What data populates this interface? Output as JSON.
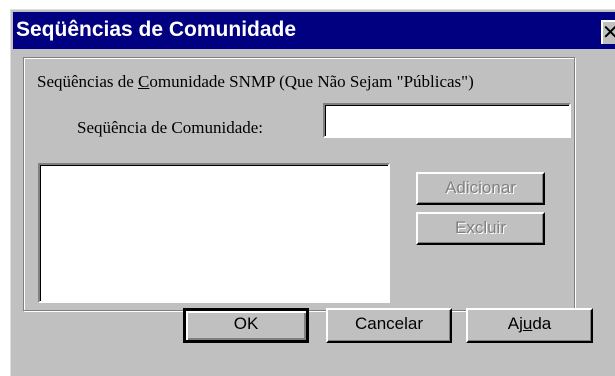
{
  "window": {
    "title": "Seqüências de Comunidade",
    "close_glyph": "✕",
    "close_icon": "close-icon"
  },
  "group": {
    "title_prefix": "Seqüências de ",
    "title_accel": "C",
    "title_suffix": "omunidade SNMP (Que Não Sejam \"Públicas\")"
  },
  "community_field": {
    "label": "Seqüência de Comunidade:",
    "value": "",
    "placeholder": ""
  },
  "community_list": {
    "items": []
  },
  "buttons": {
    "add": "Adicionar",
    "remove": "Excluir",
    "ok": "OK",
    "cancel": "Cancelar",
    "help_prefix": "Aj",
    "help_accel": "u",
    "help_suffix": "da"
  },
  "colors": {
    "title_bar": "#000080",
    "dialog_face": "#c0c0c0",
    "disabled_text": "#808080"
  }
}
